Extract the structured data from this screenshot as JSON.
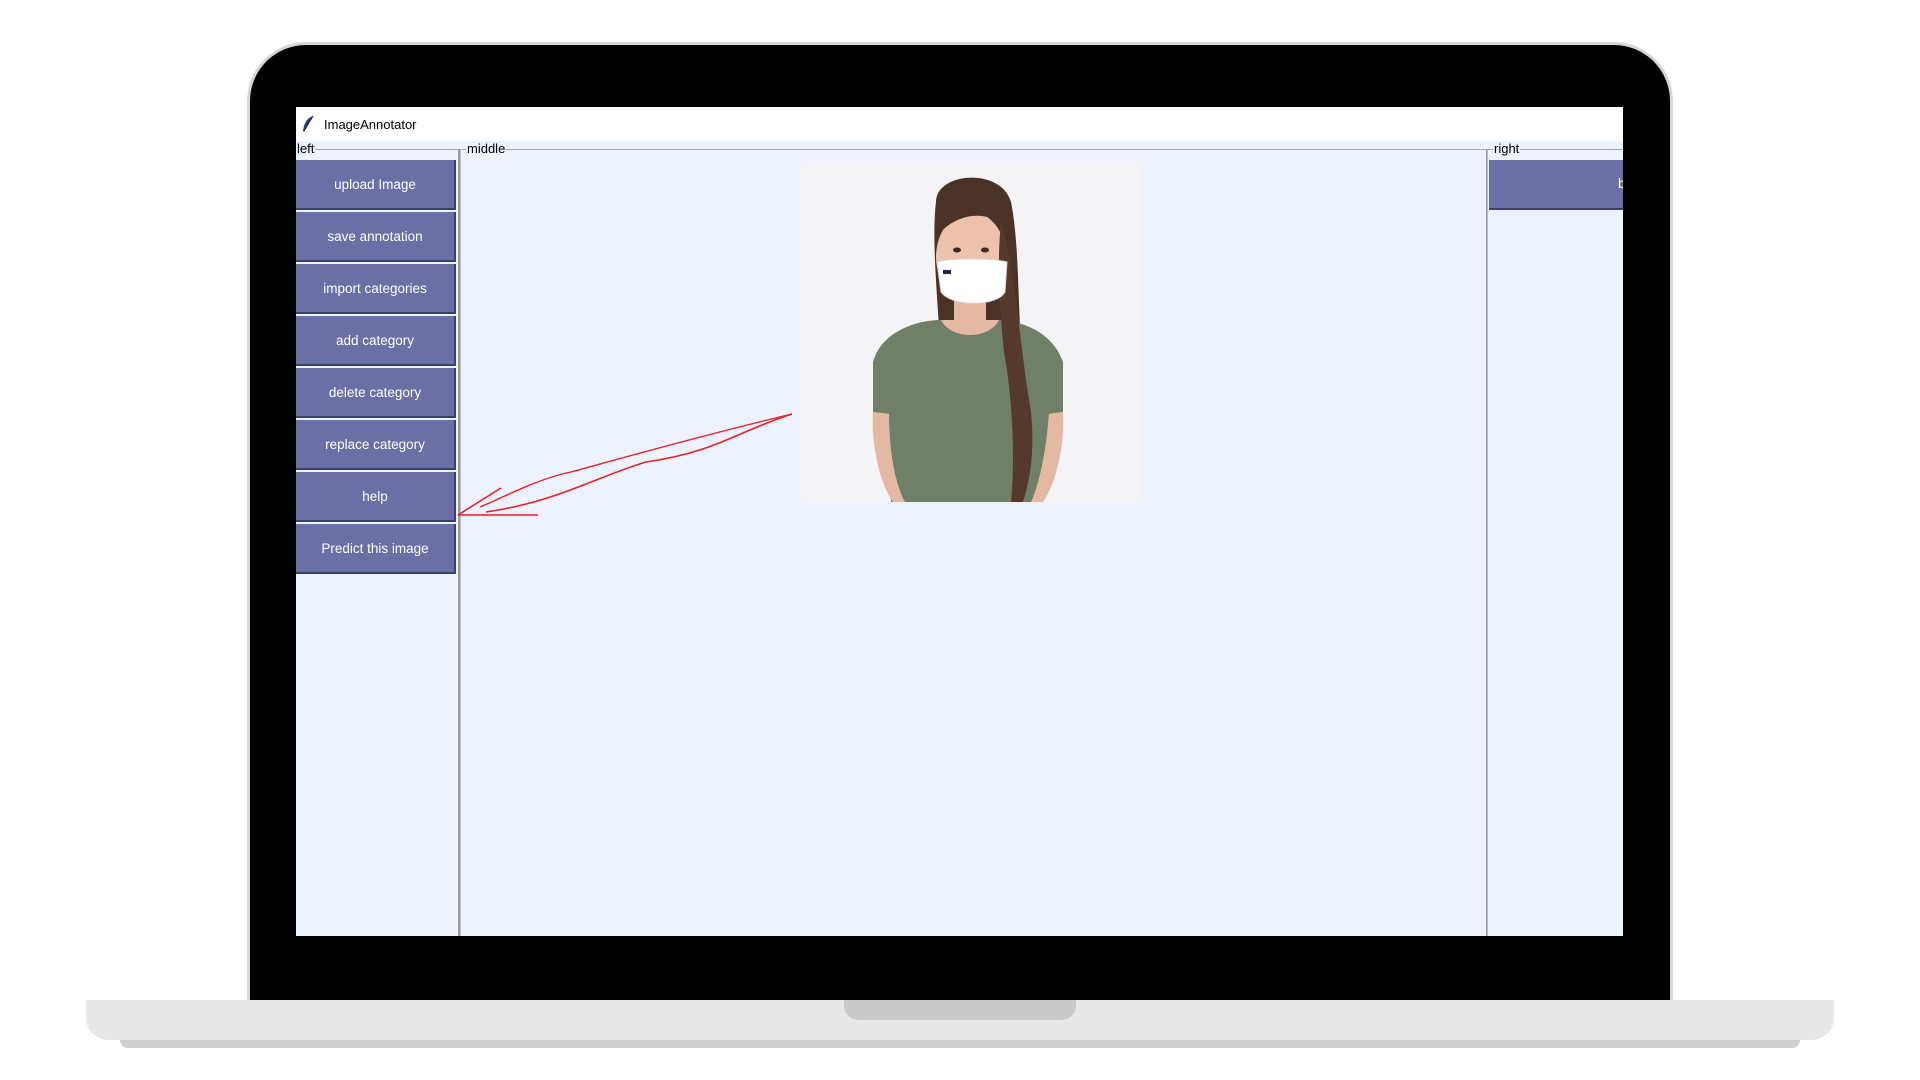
{
  "window": {
    "title": "ImageAnnotator"
  },
  "frames": {
    "left": "left",
    "middle": "middle",
    "right": "right"
  },
  "left_buttons": [
    {
      "label": "upload Image"
    },
    {
      "label": "save annotation"
    },
    {
      "label": "import categories"
    },
    {
      "label": "add category"
    },
    {
      "label": "delete category"
    },
    {
      "label": "replace category"
    },
    {
      "label": "help"
    },
    {
      "label": "Predict this image"
    }
  ],
  "right_button": {
    "label": "b"
  },
  "image": {
    "subject": "woman wearing white face mask and green t-shirt"
  },
  "colors": {
    "button_bg": "#6b6fa5",
    "app_bg": "#eef2fc",
    "annotation_stroke": "#e8202a"
  }
}
